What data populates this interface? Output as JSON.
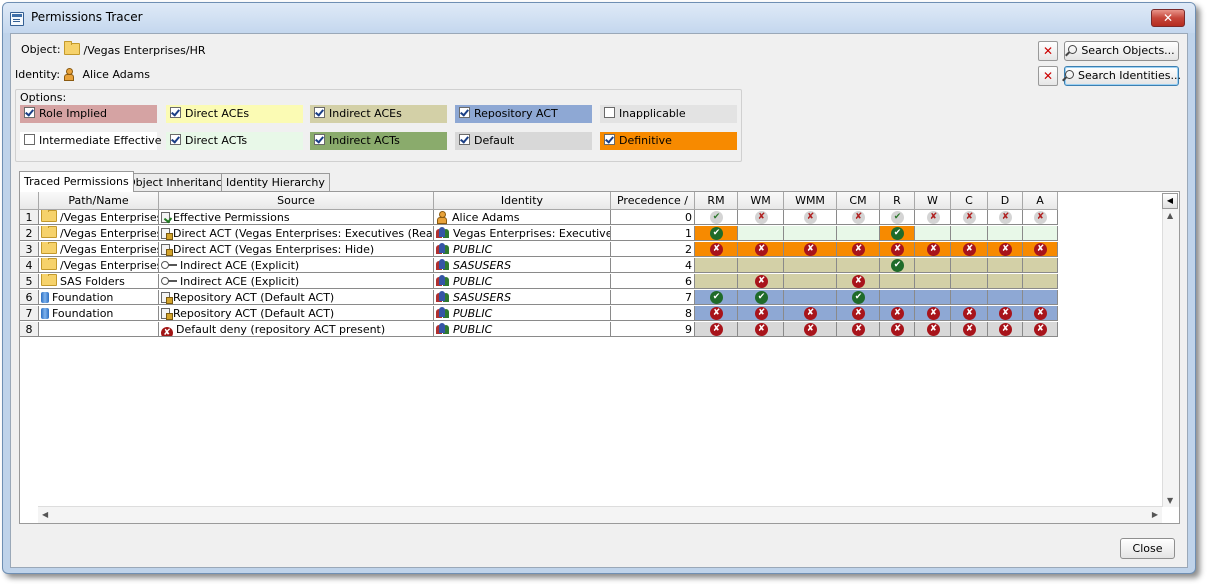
{
  "window": {
    "title": "Permissions Tracer",
    "close_glyph": "✕"
  },
  "object": {
    "label": "Object:",
    "value": "/Vegas Enterprises/HR"
  },
  "identity": {
    "label": "Identity:",
    "value": "Alice Adams"
  },
  "buttons": {
    "search_objects": "Search Objects...",
    "search_identities": "Search Identities...",
    "close": "Close",
    "clear": "✕"
  },
  "options": {
    "label": "Options:",
    "items": [
      {
        "label": "Role Implied",
        "checked": true,
        "color": "#d5a3a3"
      },
      {
        "label": "Direct ACEs",
        "checked": true,
        "color": "#fbfbb4"
      },
      {
        "label": "Indirect ACEs",
        "checked": true,
        "color": "#d3d0a7"
      },
      {
        "label": "Repository ACT",
        "checked": true,
        "color": "#8ea8d4"
      },
      {
        "label": "Inapplicable",
        "checked": false,
        "color": "#e3e3e3"
      },
      {
        "label": "Intermediate Effective",
        "checked": false,
        "color": "#ffffff"
      },
      {
        "label": "Direct ACTs",
        "checked": true,
        "color": "#e8f8e8"
      },
      {
        "label": "Indirect ACTs",
        "checked": true,
        "color": "#8aab6c"
      },
      {
        "label": "Default",
        "checked": true,
        "color": "#d8d8d8"
      },
      {
        "label": "Definitive",
        "checked": true,
        "color": "#f78a00"
      }
    ]
  },
  "tabs": [
    "Traced Permissions",
    "Object Inheritance",
    "Identity Hierarchy"
  ],
  "columns": [
    "",
    "Path/Name",
    "Source",
    "Identity",
    "Precedence /",
    "RM",
    "WM",
    "WMM",
    "CM",
    "R",
    "W",
    "C",
    "D",
    "A"
  ],
  "rows": [
    {
      "num": "1",
      "path": "/Vegas Enterprises/HR",
      "path_icon": "folder-icon",
      "source": "Effective Permissions",
      "source_icon": "effective-doc-icon",
      "identity": "Alice Adams",
      "identity_icon": "user-icon",
      "italic": false,
      "precedence": "0",
      "bg": "#ffffff",
      "perms": [
        "yes-l",
        "no-l",
        "no-l",
        "no-l",
        "yes-l",
        "no-l",
        "no-l",
        "no-l",
        "no-l"
      ]
    },
    {
      "num": "2",
      "path": "/Vegas Enterprises/HR",
      "path_icon": "folder-icon",
      "source": "Direct ACT (Vegas Enterprises: Executives (Read))",
      "source_icon": "act-doc-icon",
      "identity": "Vegas Enterprises: Executives",
      "identity_icon": "group-icon",
      "italic": false,
      "precedence": "1",
      "bg": "#e8f8e8",
      "perms": [
        "yes",
        "",
        "",
        "",
        "yes",
        "",
        "",
        "",
        ""
      ],
      "definitive": [
        0,
        4
      ]
    },
    {
      "num": "3",
      "path": "/Vegas Enterprises/HR",
      "path_icon": "folder-icon",
      "source": "Direct ACT (Vegas Enterprises: Hide)",
      "source_icon": "act-doc-icon",
      "identity": "PUBLIC",
      "identity_icon": "group-icon",
      "italic": true,
      "precedence": "2",
      "bg": "#f78a00",
      "perms": [
        "no",
        "no",
        "no",
        "no",
        "no",
        "no",
        "no",
        "no",
        "no"
      ]
    },
    {
      "num": "4",
      "path": "/Vegas Enterprises",
      "path_icon": "folder-icon",
      "source": "Indirect ACE (Explicit)",
      "source_icon": "key-icon",
      "identity": "SASUSERS",
      "identity_icon": "group-icon",
      "italic": true,
      "precedence": "4",
      "bg": "#d3d0a7",
      "perms": [
        "",
        "",
        "",
        "",
        "yes",
        "",
        "",
        "",
        ""
      ]
    },
    {
      "num": "5",
      "path": "SAS Folders",
      "path_icon": "folder-icon",
      "source": "Indirect ACE (Explicit)",
      "source_icon": "key-icon",
      "identity": "PUBLIC",
      "identity_icon": "group-icon",
      "italic": true,
      "precedence": "6",
      "bg": "#d3d0a7",
      "perms": [
        "",
        "no",
        "",
        "no",
        "",
        "",
        "",
        "",
        ""
      ]
    },
    {
      "num": "6",
      "path": "Foundation",
      "path_icon": "repository-icon",
      "source": "Repository ACT (Default ACT)",
      "source_icon": "act-doc-icon",
      "identity": "SASUSERS",
      "identity_icon": "group-icon",
      "italic": true,
      "precedence": "7",
      "bg": "#8ea8d4",
      "perms": [
        "yes",
        "yes",
        "",
        "yes",
        "",
        "",
        "",
        "",
        ""
      ]
    },
    {
      "num": "7",
      "path": "Foundation",
      "path_icon": "repository-icon",
      "source": "Repository ACT (Default ACT)",
      "source_icon": "act-doc-icon",
      "identity": "PUBLIC",
      "identity_icon": "group-icon",
      "italic": true,
      "precedence": "8",
      "bg": "#8ea8d4",
      "perms": [
        "no",
        "no",
        "no",
        "no",
        "no",
        "no",
        "no",
        "no",
        "no"
      ]
    },
    {
      "num": "8",
      "path": "",
      "path_icon": "",
      "source": "Default deny (repository ACT present)",
      "source_icon": "deny-icon",
      "identity": "PUBLIC",
      "identity_icon": "group-icon",
      "italic": true,
      "precedence": "9",
      "bg": "#d8d8d8",
      "perms": [
        "no",
        "no",
        "no",
        "no",
        "no",
        "no",
        "no",
        "no",
        "no"
      ]
    }
  ],
  "marks": {
    "yes": "✔",
    "no": "✘"
  }
}
